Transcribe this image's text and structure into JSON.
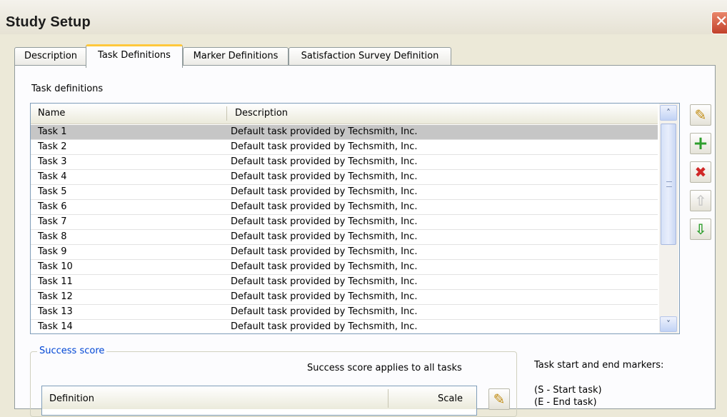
{
  "window": {
    "title": "Study Setup",
    "close_glyph": "✕"
  },
  "tabs": [
    {
      "label": "Description"
    },
    {
      "label": "Task Definitions"
    },
    {
      "label": "Marker Definitions"
    },
    {
      "label": "Satisfaction Survey Definition"
    }
  ],
  "task_definitions": {
    "label": "Task definitions",
    "columns": {
      "name": "Name",
      "description": "Description"
    },
    "rows": [
      {
        "name": "Task 1",
        "description": "Default task provided by Techsmith, Inc."
      },
      {
        "name": "Task 2",
        "description": "Default task provided by Techsmith, Inc."
      },
      {
        "name": "Task 3",
        "description": "Default task provided by Techsmith, Inc."
      },
      {
        "name": "Task 4",
        "description": "Default task provided by Techsmith, Inc."
      },
      {
        "name": "Task 5",
        "description": "Default task provided by Techsmith, Inc."
      },
      {
        "name": "Task 6",
        "description": "Default task provided by Techsmith, Inc."
      },
      {
        "name": "Task 7",
        "description": "Default task provided by Techsmith, Inc."
      },
      {
        "name": "Task 8",
        "description": "Default task provided by Techsmith, Inc."
      },
      {
        "name": "Task 9",
        "description": "Default task provided by Techsmith, Inc."
      },
      {
        "name": "Task 10",
        "description": "Default task provided by Techsmith, Inc."
      },
      {
        "name": "Task 11",
        "description": "Default task provided by Techsmith, Inc."
      },
      {
        "name": "Task 12",
        "description": "Default task provided by Techsmith, Inc."
      },
      {
        "name": "Task 13",
        "description": "Default task provided by Techsmith, Inc."
      },
      {
        "name": "Task 14",
        "description": "Default task provided by Techsmith, Inc."
      }
    ],
    "selected_row": "Task 1",
    "scroll_up_glyph": "˄",
    "scroll_down_glyph": "˅"
  },
  "toolbar": {
    "edit_icon": "edit-icon",
    "add_icon": "add-icon",
    "delete_icon": "delete-icon",
    "move_up_icon": "move-up-icon",
    "move_down_icon": "move-down-icon",
    "edit_glyph": "✎",
    "add_glyph": "+",
    "delete_glyph": "✖",
    "move_up_glyph": "⇧",
    "move_down_glyph": "⇩"
  },
  "success_score": {
    "group_label": "Success score",
    "note": "Success score applies to all tasks",
    "columns": {
      "definition": "Definition",
      "scale": "Scale"
    }
  },
  "markers": {
    "label": "Task start and end markers:",
    "line1": "(S - Start task)",
    "line2": "(E - End task)"
  },
  "colors": {
    "tab_highlight": "#ffc83c",
    "selected_row": "#c6c6c6",
    "group_title": "#0046d5",
    "add_green": "#2e9e2e",
    "delete_red": "#d02828"
  }
}
